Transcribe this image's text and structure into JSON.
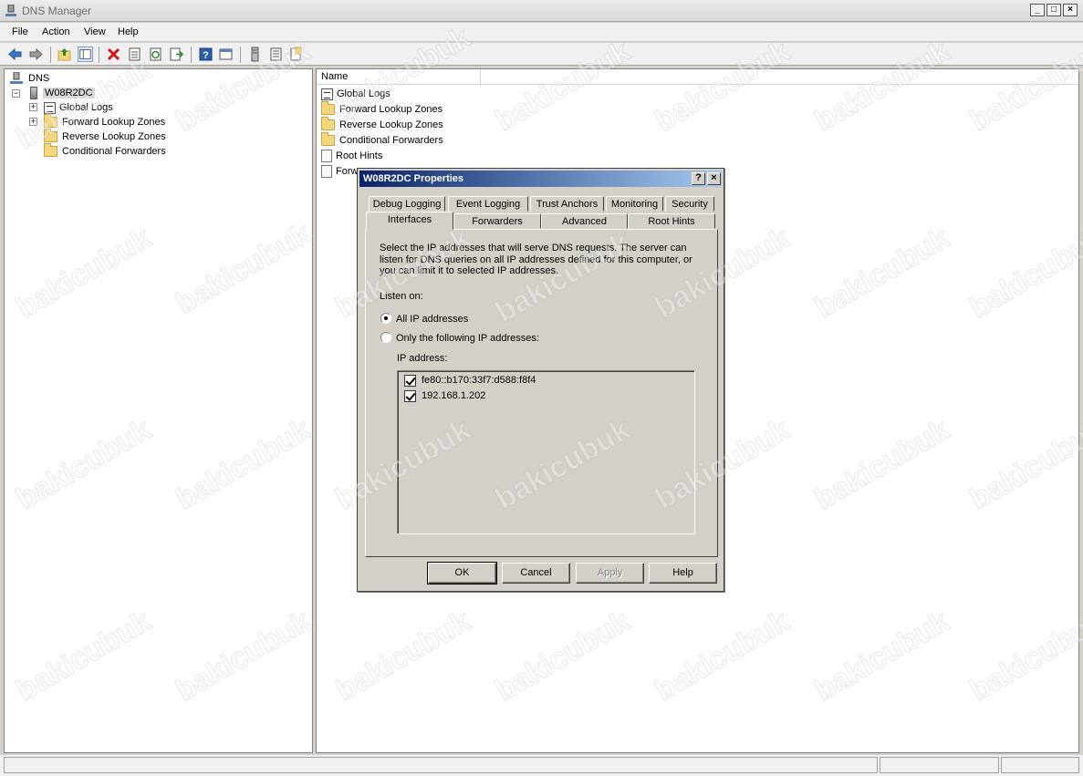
{
  "window": {
    "title": "DNS Manager",
    "min": "_",
    "max": "□",
    "close": "×"
  },
  "menu": [
    "File",
    "Action",
    "View",
    "Help"
  ],
  "tree": {
    "root": "DNS",
    "server": "W08R2DC",
    "children": [
      "Global Logs",
      "Forward Lookup Zones",
      "Reverse Lookup Zones",
      "Conditional Forwarders"
    ]
  },
  "list": {
    "column": "Name",
    "items": [
      "Global Logs",
      "Forward Lookup Zones",
      "Reverse Lookup Zones",
      "Conditional Forwarders",
      "Root Hints",
      "Forw"
    ]
  },
  "dialog": {
    "title": "W08R2DC Properties",
    "help_btn": "?",
    "close_btn": "×",
    "tabs_row1": [
      "Debug Logging",
      "Event Logging",
      "Trust Anchors",
      "Monitoring",
      "Security"
    ],
    "tabs_row2": [
      "Interfaces",
      "Forwarders",
      "Advanced",
      "Root Hints"
    ],
    "active_tab": "Interfaces",
    "description": "Select the IP addresses that will serve DNS requests. The server can listen for DNS queries on all IP addresses defined for this computer, or you can limit it to selected IP addresses.",
    "listen_on": "Listen on:",
    "radio_all": "All IP addresses",
    "radio_only": "Only the following IP addresses:",
    "radio_selected": "all",
    "ip_label": "IP address:",
    "ips": [
      {
        "address": "fe80::b170:33f7:d588:f8f4",
        "checked": true
      },
      {
        "address": "192.168.1.202",
        "checked": true
      }
    ],
    "buttons": {
      "ok": "OK",
      "cancel": "Cancel",
      "apply": "Apply",
      "help": "Help"
    }
  },
  "watermark": "bakicubuk",
  "colors": {
    "title_gradient_start": "#0a246a",
    "title_gradient_end": "#a6caf0",
    "folder": "#f4d67d"
  }
}
